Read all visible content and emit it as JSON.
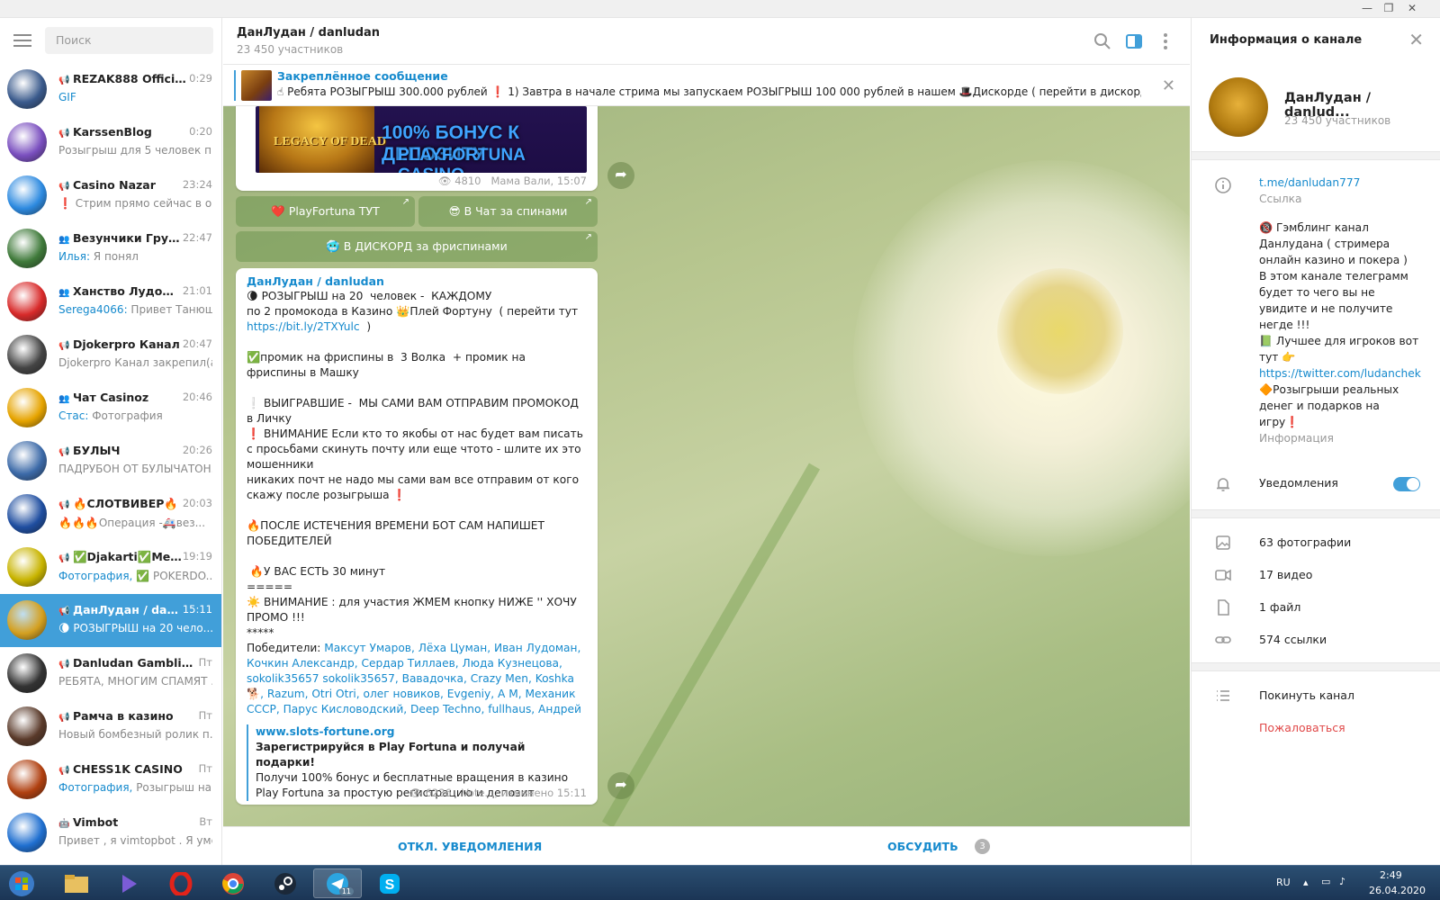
{
  "sidebar": {
    "search_placeholder": "Поиск",
    "chats": [
      {
        "name": "REZAK888 Official c...",
        "time": "0:29",
        "preview": "GIF",
        "preview_hl": "",
        "color": "#3a5a8c",
        "icon": "megaphone-icon"
      },
      {
        "name": "KarssenBlog",
        "time": "0:20",
        "preview": "Розыгрыш для 5 человек п...",
        "preview_hl": "",
        "color": "#7a4fbf",
        "icon": "megaphone-icon"
      },
      {
        "name": "Casino Nazar",
        "time": "23:24",
        "preview": "❗ Стрим прямо сейчас в о...",
        "preview_hl": "",
        "color": "#2d8ae0",
        "icon": "megaphone-icon"
      },
      {
        "name": "Везунчики Группа",
        "time": "22:47",
        "preview": " Я понял",
        "preview_hl": "Илья:",
        "color": "#3f7a3a",
        "icon": "group-icon"
      },
      {
        "name": "Ханство Лудома...",
        "time": "21:01",
        "preview": " Привет Танюш...",
        "preview_hl": "Serega4066:",
        "color": "#d82a2a",
        "icon": "group-icon"
      },
      {
        "name": "Djokerpro Канал",
        "time": "20:47",
        "preview": "Djokerpro Канал закрепил(а...",
        "preview_hl": "",
        "color": "#444",
        "icon": "megaphone-icon"
      },
      {
        "name": "Чат Casinoz",
        "time": "20:46",
        "preview": " Фотография",
        "preview_hl": "Стас:",
        "color": "#e6a400",
        "icon": "group-icon"
      },
      {
        "name": "БУЛЫЧ",
        "time": "20:26",
        "preview": "ПАДРУБОН ОТ БУЛЫЧАТОН...",
        "preview_hl": "",
        "color": "#3c6aa8",
        "icon": "megaphone-icon"
      },
      {
        "name": "🔥СЛОТВИВЕР🔥",
        "time": "20:03",
        "preview": "🔥🔥🔥Операция -🚑вез...",
        "preview_hl": "",
        "color": "#1f4ea0",
        "icon": "megaphone-icon"
      },
      {
        "name": "✅Djakarti✅Me...",
        "time": "19:19",
        "preview": " POKERDO...",
        "preview_hl": "Фотография, ✅",
        "color": "#c8b400",
        "icon": "megaphone-icon"
      },
      {
        "name": "ДанЛудан / danlu...",
        "time": "15:11",
        "preview": "🌘 РОЗЫГРЫШ на 20  чело...",
        "preview_hl": "",
        "color": "#d4a020",
        "icon": "megaphone-icon",
        "active": true
      },
      {
        "name": "Danludan Gambling ...",
        "time": "Пт",
        "preview": "РЕБЯТА, МНОГИМ СПАМЯТ ...",
        "preview_hl": "",
        "color": "#333",
        "icon": "megaphone-icon"
      },
      {
        "name": "Рамча в казино",
        "time": "Пт",
        "preview": "Новый бомбезный ролик п...",
        "preview_hl": "",
        "color": "#5a3a2a",
        "icon": "megaphone-icon"
      },
      {
        "name": "CHESS1K CASINO",
        "time": "Пт",
        "preview": " Розыгрыш на ...",
        "preview_hl": "Фотография,",
        "color": "#b04010",
        "icon": "megaphone-icon"
      },
      {
        "name": "Vimbot",
        "time": "Вт",
        "preview": "Привет , я vimtopbot . Я уме...",
        "preview_hl": "",
        "color": "#1f6fd0",
        "icon": "bot-icon"
      }
    ]
  },
  "chat": {
    "title": "ДанЛудан / danludan",
    "subtitle": "23 450 участников",
    "pinned_label": "Закреплённое сообщение",
    "pinned_text": "☝ Ребята РОЗЫГРЫШ 300.000 рублей   ❗ 1)  Завтра в начале стрима мы запускаем РОЗЫГРЫШ 100 000 рублей в нашем 🎩Дискорде ( перейти в дискорд мож...",
    "msg1": {
      "banner_line1": "100% БОНУС К ДЕПОЗИТУ",
      "banner_line2": "PLAYFORTUNA CASINO",
      "banner_game": "LEGACY OF DEAD",
      "views": "4810",
      "author_time": "Мама Вали, 15:07"
    },
    "buttons": {
      "b1": "❤️ PlayFortuna ТУТ",
      "b2": "😎 В Чат за спинами",
      "b3": "🥶 В ДИСКОРД за фриспинами"
    },
    "msg2": {
      "author": "ДанЛудан / danludan",
      "l1": "🌘 РОЗЫГРЫШ на 20  человек -  КАЖДОМУ",
      "l2": "по 2 промокода в Казино 👑Плей Фортуну  ( перейти тут",
      "l3_link": "https://bit.ly/2TXYulc",
      "l3_rest": "  )",
      "l4": "✅промик на фриспины в  3 Волка  + промик на фриспины в Машку",
      "l5": "❕ ВЫИГРАВШИЕ -  МЫ САМИ ВАМ ОТПРАВИМ ПРОМОКОД в Личку",
      "l6": "❗ ВНИМАНИЕ Если кто то якобы от нас будет вам писать с просьбами скинуть почту или еще чтото - шлите их это мошенники",
      "l7": "никаких почт не надо мы сами вам все отправим от кого скажу после розыгрыша ❗",
      "l8": "🔥ПОСЛЕ ИСТЕЧЕНИЯ ВРЕМЕНИ БОТ САМ НАПИШЕТ ПОБЕДИТЕЛЕЙ",
      "l9": " 🔥У ВАС ЕСТЬ 30 минут",
      "l10": "=====",
      "l11": "☀️ ВНИМАНИЕ : для участия ЖМЕМ кнопку НИЖЕ '' ХОЧУ ПРОМО !!!",
      "l12": "*****",
      "winners_label": "Победители: ",
      "winners": "Максут Умаров, Лёха Цуман, Иван Лудоман, Кочкин Александр, Сердар Тиллаев, Люда Кузнецова, sokolik35657 sokolik35657, Вавадочка, Crazy Men, Koshka 🐕, Razum, Otri Otri, олег новиков, Evgeniy, A M, Механик СССР, Парус Кисловодский, Deep Techno, fullhaus, Андрей",
      "lp_site": "www.slots-fortune.org",
      "lp_title": "Зарегистрируйся в Play Fortuna и получай подарки!",
      "lp_desc": "Получи 100% бонус и бесплатные вращения в казино Play Fortuna за простую регистрацию и депозит",
      "views": "6236",
      "author_time": "Vote..., изменено 15:11"
    },
    "footer_mute": "ОТКЛ. УВЕДОМЛЕНИЯ",
    "footer_discuss": "ОБСУДИТЬ",
    "footer_count": "3"
  },
  "info": {
    "header": "Информация о канале",
    "name": "ДанЛудан / danlud...",
    "members": "23 450 участников",
    "link": "t.me/danludan777",
    "link_label": "Ссылка",
    "desc1": "🔞 Гэмблинг канал Данлудана ( стримера онлайн казино и покера )",
    "desc2": "В этом канале телеграмм будет то чего вы не увидите и не получите негде !!!",
    "desc3": "📗 Лучшее для игроков вот тут 👉",
    "desc_link": "https://twitter.com/ludanchek",
    "desc4": "🔶Розыгрыши реальных денег и подарков на игру❗",
    "desc_label": "Информация",
    "notifications": "Уведомления",
    "media": [
      {
        "label": "63 фотографии",
        "icon": "photo-icon"
      },
      {
        "label": "17 видео",
        "icon": "video-icon"
      },
      {
        "label": "1 файл",
        "icon": "file-icon"
      },
      {
        "label": "574 ссылки",
        "icon": "link-icon"
      }
    ],
    "leave": "Покинуть канал",
    "report": "Пожаловаться"
  },
  "taskbar": {
    "lang": "RU",
    "time": "2:49",
    "date": "26.04.2020",
    "telegram_badge": "11"
  }
}
